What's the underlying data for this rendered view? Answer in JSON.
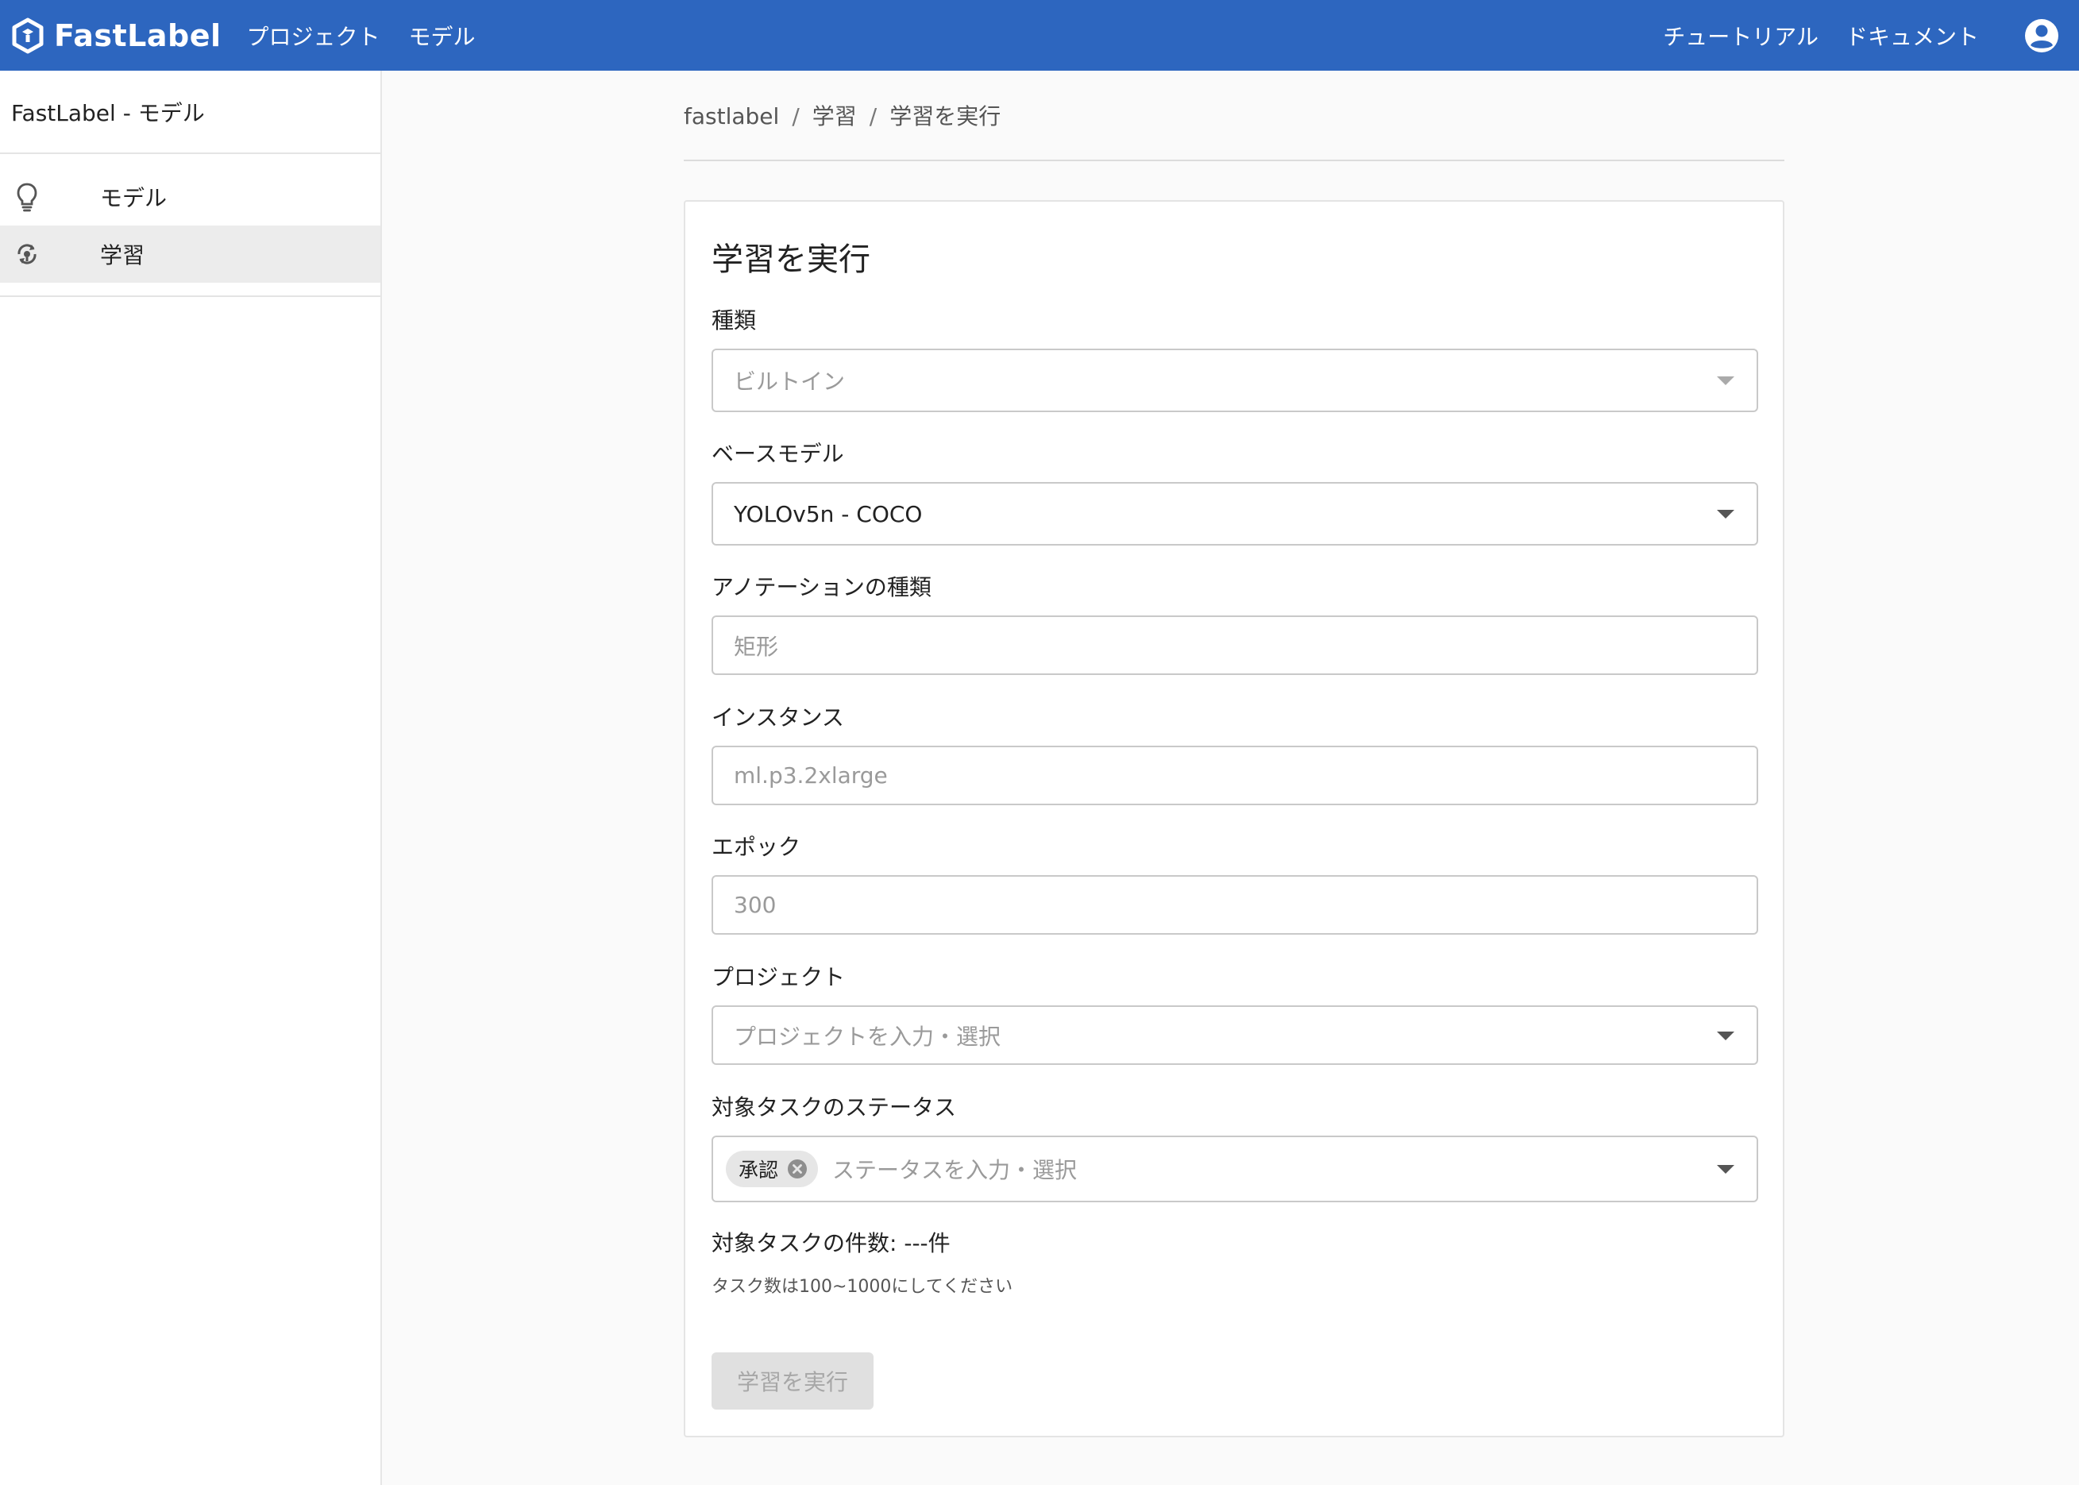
{
  "header": {
    "brand": "FastLabel",
    "nav": [
      "プロジェクト",
      "モデル"
    ],
    "right_links": [
      "チュートリアル",
      "ドキュメント"
    ]
  },
  "sidebar": {
    "title": "FastLabel - モデル",
    "items": [
      {
        "label": "モデル",
        "icon": "lightbulb-icon",
        "active": false
      },
      {
        "label": "学習",
        "icon": "training-icon",
        "active": true
      }
    ]
  },
  "breadcrumb": [
    "fastlabel",
    "学習",
    "学習を実行"
  ],
  "form": {
    "title": "学習を実行",
    "type": {
      "label": "種類",
      "value": "ビルトイン",
      "disabled": true
    },
    "base_model": {
      "label": "ベースモデル",
      "value": "YOLOv5n - COCO"
    },
    "annotation_type": {
      "label": "アノテーションの種類",
      "value": "矩形",
      "disabled": true
    },
    "instance": {
      "label": "インスタンス",
      "value": "ml.p3.2xlarge",
      "disabled": true
    },
    "epoch": {
      "label": "エポック",
      "value": "300",
      "disabled": true
    },
    "project": {
      "label": "プロジェクト",
      "placeholder": "プロジェクトを入力・選択"
    },
    "status": {
      "label": "対象タスクのステータス",
      "chips": [
        "承認"
      ],
      "placeholder": "ステータスを入力・選択"
    },
    "task_count": "対象タスクの件数: ---件",
    "helper": "タスク数は100~1000にしてください",
    "submit_label": "学習を実行"
  },
  "colors": {
    "header_bg": "#2d66bf",
    "active_item_bg": "#ececec",
    "disabled_button_bg": "#e0e0e0"
  }
}
